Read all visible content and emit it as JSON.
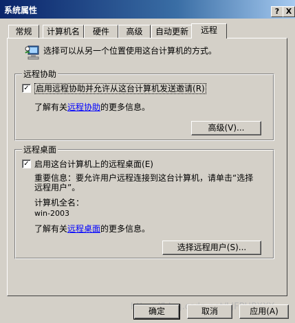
{
  "window": {
    "title": "系统属性",
    "help_btn": "?",
    "close_btn": "X"
  },
  "tabs": [
    {
      "label": "常规"
    },
    {
      "label": "计算机名"
    },
    {
      "label": "硬件"
    },
    {
      "label": "高级"
    },
    {
      "label": "自动更新"
    },
    {
      "label": "远程"
    }
  ],
  "intro": {
    "text": "选择可以从另一个位置使用这台计算机的方式。",
    "icon": "remote-computer-icon"
  },
  "remote_assistance": {
    "legend": "远程协助",
    "checkbox_label": "启用远程协助并允许从这台计算机发送邀请",
    "checkbox_accel": "(R)",
    "checked": true,
    "info_prefix": "了解有关",
    "info_link": "远程协助",
    "info_suffix": "的更多信息。",
    "advanced_button": "高级(V)..."
  },
  "remote_desktop": {
    "legend": "远程桌面",
    "checkbox_label": "启用这台计算机上的远程桌面",
    "checkbox_accel": "(E)",
    "checked": true,
    "important_line1": "重要信息：要允许用户远程连接到这台计算机，请单击“选择",
    "important_line2": "远程用户”。",
    "computer_name_label": "计算机全名：",
    "computer_name": "win-2003",
    "info_prefix": "了解有关",
    "info_link": "远程桌面",
    "info_suffix": "的更多信息。",
    "select_users_button": "选择远程用户(S)..."
  },
  "footer": {
    "ok": "确定",
    "cancel": "取消",
    "apply": "应用(A)",
    "watermark": "https://blog.csdn.net/LJFPHPXXY"
  }
}
